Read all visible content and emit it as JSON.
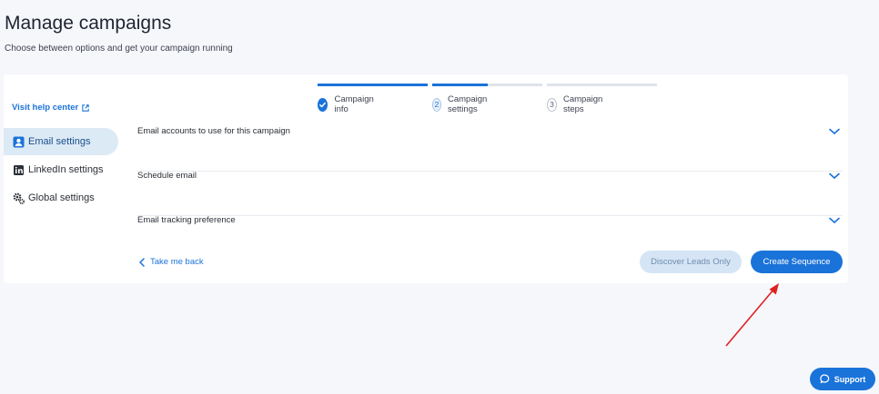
{
  "header": {
    "title": "Manage campaigns",
    "subtitle": "Choose between options and get your campaign running"
  },
  "sidebar": {
    "help_link": "Visit help center",
    "items": [
      {
        "label": "Email settings",
        "icon": "email-icon",
        "active": true
      },
      {
        "label": "LinkedIn settings",
        "icon": "linkedin-icon",
        "active": false
      },
      {
        "label": "Global settings",
        "icon": "gears-icon",
        "active": false
      }
    ]
  },
  "stepper": {
    "steps": [
      {
        "label": "Campaign info",
        "number": "",
        "state": "done",
        "progress": 1.0
      },
      {
        "label": "Campaign settings",
        "number": "2",
        "state": "current",
        "progress": 0.5
      },
      {
        "label": "Campaign steps",
        "number": "3",
        "state": "todo",
        "progress": 0.0
      }
    ]
  },
  "sections": [
    {
      "label": "Email accounts to use for this campaign"
    },
    {
      "label": "Schedule email"
    },
    {
      "label": "Email tracking preference"
    }
  ],
  "footer": {
    "back_label": "Take me back",
    "discover_label": "Discover Leads Only",
    "create_label": "Create Sequence"
  },
  "support": {
    "label": "Support"
  },
  "colors": {
    "accent": "#1a73d9",
    "annotation_arrow": "#e02020"
  }
}
